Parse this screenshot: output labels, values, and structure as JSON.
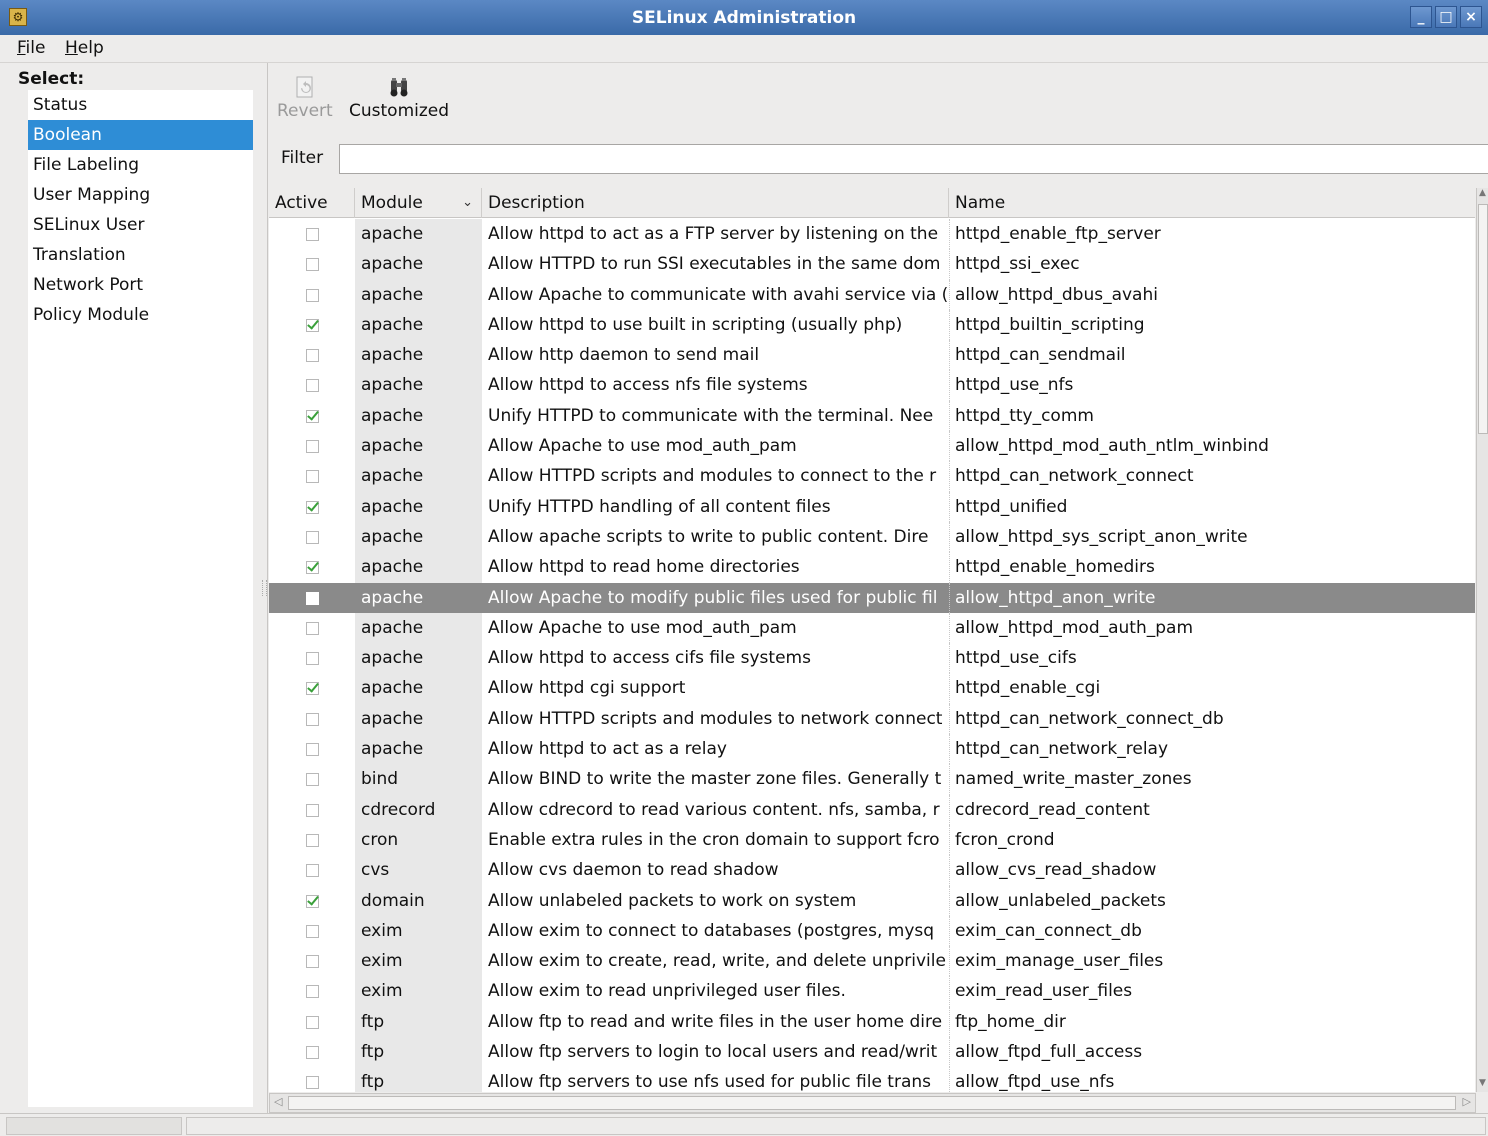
{
  "window": {
    "title": "SELinux Administration",
    "minimize_label": "_",
    "maximize_label": "□",
    "close_label": "×",
    "app_icon": "selinux-app-icon"
  },
  "menubar": {
    "file": {
      "accel": "F",
      "rest": "ile"
    },
    "help": {
      "accel": "H",
      "rest": "elp"
    }
  },
  "sidebar": {
    "heading": "Select:",
    "items": [
      {
        "label": "Status"
      },
      {
        "label": "Boolean",
        "selected": true
      },
      {
        "label": "File Labeling"
      },
      {
        "label": "User Mapping"
      },
      {
        "label": "SELinux User"
      },
      {
        "label": "Translation"
      },
      {
        "label": "Network Port"
      },
      {
        "label": "Policy Module"
      }
    ]
  },
  "toolbar": {
    "revert_label": "Revert",
    "revert_icon": "revert-icon",
    "customized_label": "Customized",
    "customized_icon": "binoculars-icon"
  },
  "filter": {
    "label": "Filter",
    "value": ""
  },
  "table": {
    "headers": {
      "active": "Active",
      "module": "Module",
      "description": "Description",
      "name": "Name"
    },
    "sort_indicator": "⌄",
    "rows": [
      {
        "active": false,
        "module": "apache",
        "description": "Allow httpd to act as a FTP server by listening on the",
        "name": "httpd_enable_ftp_server"
      },
      {
        "active": false,
        "module": "apache",
        "description": "Allow HTTPD to run SSI executables in the same dom",
        "name": "httpd_ssi_exec"
      },
      {
        "active": false,
        "module": "apache",
        "description": "Allow Apache to communicate with avahi service via (",
        "name": "allow_httpd_dbus_avahi"
      },
      {
        "active": true,
        "module": "apache",
        "description": "Allow httpd to use built in scripting (usually php)",
        "name": "httpd_builtin_scripting"
      },
      {
        "active": false,
        "module": "apache",
        "description": "Allow http daemon to send mail",
        "name": "httpd_can_sendmail"
      },
      {
        "active": false,
        "module": "apache",
        "description": "Allow httpd to access nfs file systems",
        "name": "httpd_use_nfs"
      },
      {
        "active": true,
        "module": "apache",
        "description": "Unify HTTPD to communicate with the terminal.  Nee",
        "name": "httpd_tty_comm"
      },
      {
        "active": false,
        "module": "apache",
        "description": "Allow Apache to use mod_auth_pam",
        "name": "allow_httpd_mod_auth_ntlm_winbind"
      },
      {
        "active": false,
        "module": "apache",
        "description": "Allow HTTPD scripts and modules to connect to the r",
        "name": "httpd_can_network_connect"
      },
      {
        "active": true,
        "module": "apache",
        "description": "Unify HTTPD handling of all content files",
        "name": "httpd_unified"
      },
      {
        "active": false,
        "module": "apache",
        "description": "Allow apache scripts to write to public content.  Dire",
        "name": "allow_httpd_sys_script_anon_write"
      },
      {
        "active": true,
        "module": "apache",
        "description": "Allow httpd to read home directories",
        "name": "httpd_enable_homedirs"
      },
      {
        "active": false,
        "module": "apache",
        "description": "Allow Apache to modify public files used for public fil",
        "name": "allow_httpd_anon_write",
        "selected": true
      },
      {
        "active": false,
        "module": "apache",
        "description": "Allow Apache to use mod_auth_pam",
        "name": "allow_httpd_mod_auth_pam"
      },
      {
        "active": false,
        "module": "apache",
        "description": "Allow httpd to access cifs file systems",
        "name": "httpd_use_cifs"
      },
      {
        "active": true,
        "module": "apache",
        "description": "Allow httpd cgi support",
        "name": "httpd_enable_cgi"
      },
      {
        "active": false,
        "module": "apache",
        "description": "Allow HTTPD scripts and modules to network connect",
        "name": "httpd_can_network_connect_db"
      },
      {
        "active": false,
        "module": "apache",
        "description": "Allow httpd to act as a relay",
        "name": "httpd_can_network_relay"
      },
      {
        "active": false,
        "module": "bind",
        "description": "Allow BIND to write the master zone files. Generally t",
        "name": "named_write_master_zones"
      },
      {
        "active": false,
        "module": "cdrecord",
        "description": "Allow cdrecord to read various content. nfs, samba, r",
        "name": "cdrecord_read_content"
      },
      {
        "active": false,
        "module": "cron",
        "description": "Enable extra rules in the cron domain to support fcro",
        "name": "fcron_crond"
      },
      {
        "active": false,
        "module": "cvs",
        "description": "Allow cvs daemon to read shadow",
        "name": "allow_cvs_read_shadow"
      },
      {
        "active": true,
        "module": "domain",
        "description": "Allow unlabeled packets to work on system",
        "name": "allow_unlabeled_packets"
      },
      {
        "active": false,
        "module": "exim",
        "description": "Allow exim to connect to databases (postgres, mysq",
        "name": "exim_can_connect_db"
      },
      {
        "active": false,
        "module": "exim",
        "description": "Allow exim to create, read, write, and delete unprivile",
        "name": "exim_manage_user_files"
      },
      {
        "active": false,
        "module": "exim",
        "description": "Allow exim to read unprivileged user files.",
        "name": "exim_read_user_files"
      },
      {
        "active": false,
        "module": "ftp",
        "description": "Allow ftp to read and write files in the user home dire",
        "name": "ftp_home_dir"
      },
      {
        "active": false,
        "module": "ftp",
        "description": "Allow ftp servers to login to local users and read/writ",
        "name": "allow_ftpd_full_access"
      },
      {
        "active": false,
        "module": "ftp",
        "description": "Allow ftp servers to use nfs used for public file trans",
        "name": "allow_ftpd_use_nfs"
      }
    ]
  },
  "colors": {
    "titlebar": "#3a6aa8",
    "selection": "#2e8dd6",
    "row_selected": "#8a8a8a",
    "check": "#3aa03a"
  }
}
